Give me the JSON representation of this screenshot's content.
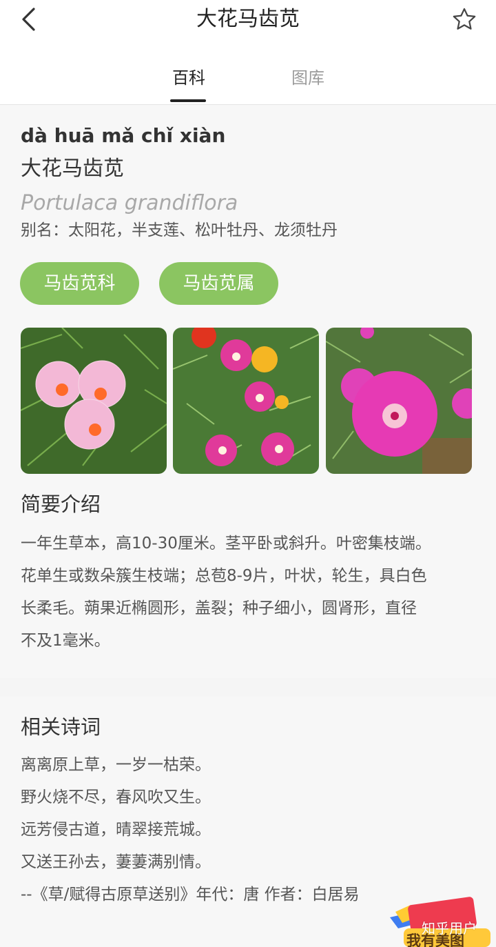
{
  "header": {
    "title": "大花马齿苋",
    "back_icon": "chevron-left-icon",
    "favorite_icon": "star-outline-icon"
  },
  "tabs": [
    {
      "label": "百科",
      "active": true
    },
    {
      "label": "图库",
      "active": false
    }
  ],
  "plant": {
    "pinyin": "dà huā mǎ chǐ xiàn",
    "name": "大花马齿苋",
    "latin": "Portulaca grandiflora",
    "alias": "别名：太阳花，半支莲、松叶牡丹、龙须牡丹",
    "tags": [
      "马齿苋科",
      "马齿苋属"
    ],
    "tag_color": "#8bc561"
  },
  "intro": {
    "title": "简要介绍",
    "lines": [
      "一年生草本，高10-30厘米。茎平卧或斜升。叶密集枝端。",
      "花单生或数朵簇生枝端；总苞8-9片，叶状，轮生，具白色",
      "长柔毛。蒴果近椭圆形，盖裂；种子细小，圆肾形，直径",
      "不及1毫米。"
    ]
  },
  "poem": {
    "title": "相关诗词",
    "lines": [
      "离离原上草，一岁一枯荣。",
      "野火烧不尽，春风吹又生。",
      "远芳侵古道，晴翠接荒城。",
      "又送王孙去，萋萋满别情。",
      "--《草/赋得古原草送别》年代：唐 作者：白居易"
    ]
  },
  "badge": {
    "label": "我有美图"
  },
  "watermark": "知乎用户"
}
